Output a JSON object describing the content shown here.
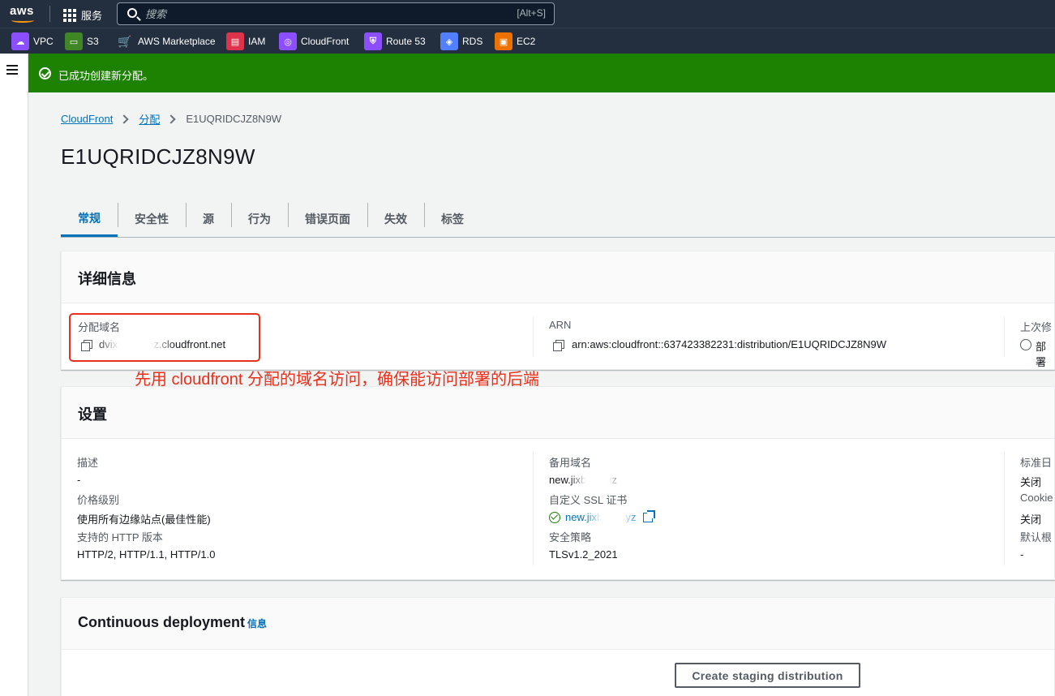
{
  "topbar": {
    "logo": "aws",
    "services_label": "服务",
    "search_placeholder": "搜索",
    "search_shortcut": "[Alt+S]"
  },
  "favorites": [
    {
      "label": "VPC",
      "icon": "vpc-icon",
      "color": "#8c4fff"
    },
    {
      "label": "S3",
      "icon": "s3-icon",
      "color": "#3f8624"
    },
    {
      "label": "AWS Marketplace",
      "icon": "cart-icon",
      "color": "#232f3e"
    },
    {
      "label": "IAM",
      "icon": "iam-icon",
      "color": "#dd344c"
    },
    {
      "label": "CloudFront",
      "icon": "cloudfront-icon",
      "color": "#8c4fff"
    },
    {
      "label": "Route 53",
      "icon": "route53-icon",
      "color": "#8c4fff"
    },
    {
      "label": "RDS",
      "icon": "rds-icon",
      "color": "#527fff"
    },
    {
      "label": "EC2",
      "icon": "ec2-icon",
      "color": "#ed7100"
    }
  ],
  "flash": {
    "message": "已成功创建新分配。",
    "color": "#1d8102"
  },
  "breadcrumb": {
    "root": "CloudFront",
    "parent": "分配",
    "current": "E1UQRIDCJZ8N9W"
  },
  "page_title": "E1UQRIDCJZ8N9W",
  "tabs": [
    "常规",
    "安全性",
    "源",
    "行为",
    "错误页面",
    "失效",
    "标签"
  ],
  "details": {
    "title": "详细信息",
    "domain_label": "分配域名",
    "domain_value": "dvixabrtqopz.cloudfront.net",
    "arn_label": "ARN",
    "arn_value": "arn:aws:cloudfront::637423382231:distribution/E1UQRIDCJZ8N9W",
    "last_modified_label": "上次修",
    "last_modified_value": "部署"
  },
  "annotation": "先用 cloudfront 分配的域名访问，确保能访问部署的后端",
  "settings": {
    "title": "设置",
    "description_label": "描述",
    "description_value": "-",
    "price_class_label": "价格级别",
    "price_class_value": "使用所有边缘站点(最佳性能)",
    "http_label": "支持的 HTTP 版本",
    "http_value": "HTTP/2, HTTP/1.1, HTTP/1.0",
    "alt_domain_label": "备用域名",
    "alt_domain_value": "new.jixbnetxyz",
    "ssl_label": "自定义 SSL 证书",
    "ssl_value": "new.jixbnet.xyz",
    "policy_label": "安全策略",
    "policy_value": "TLSv1.2_2021",
    "std_log_label": "标准日",
    "std_log_value": "关闭",
    "cookie_label": "Cookie",
    "cookie_value": "关闭",
    "default_root_label": "默认根",
    "default_root_value": "-"
  },
  "continuous": {
    "title": "Continuous deployment",
    "info": "信息",
    "button": "Create staging distribution"
  }
}
